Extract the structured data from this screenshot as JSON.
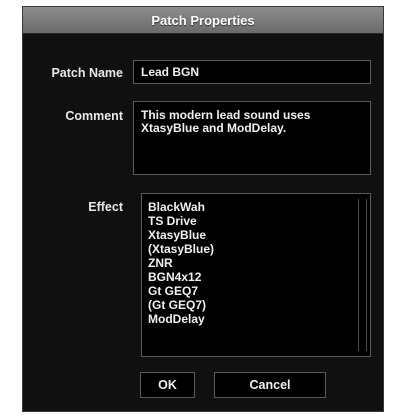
{
  "dialog": {
    "title": "Patch Properties"
  },
  "fields": {
    "patch_name_label": "Patch Name",
    "patch_name_value": "Lead BGN",
    "comment_label": "Comment",
    "comment_value": "This modern lead sound uses\nXtasyBlue and ModDelay.",
    "effect_label": "Effect"
  },
  "effects": [
    "BlackWah",
    "TS Drive",
    "XtasyBlue",
    "(XtasyBlue)",
    "ZNR",
    "BGN4x12",
    "Gt GEQ7",
    "(Gt GEQ7)",
    "ModDelay"
  ],
  "buttons": {
    "ok_label": "OK",
    "cancel_label": "Cancel"
  }
}
